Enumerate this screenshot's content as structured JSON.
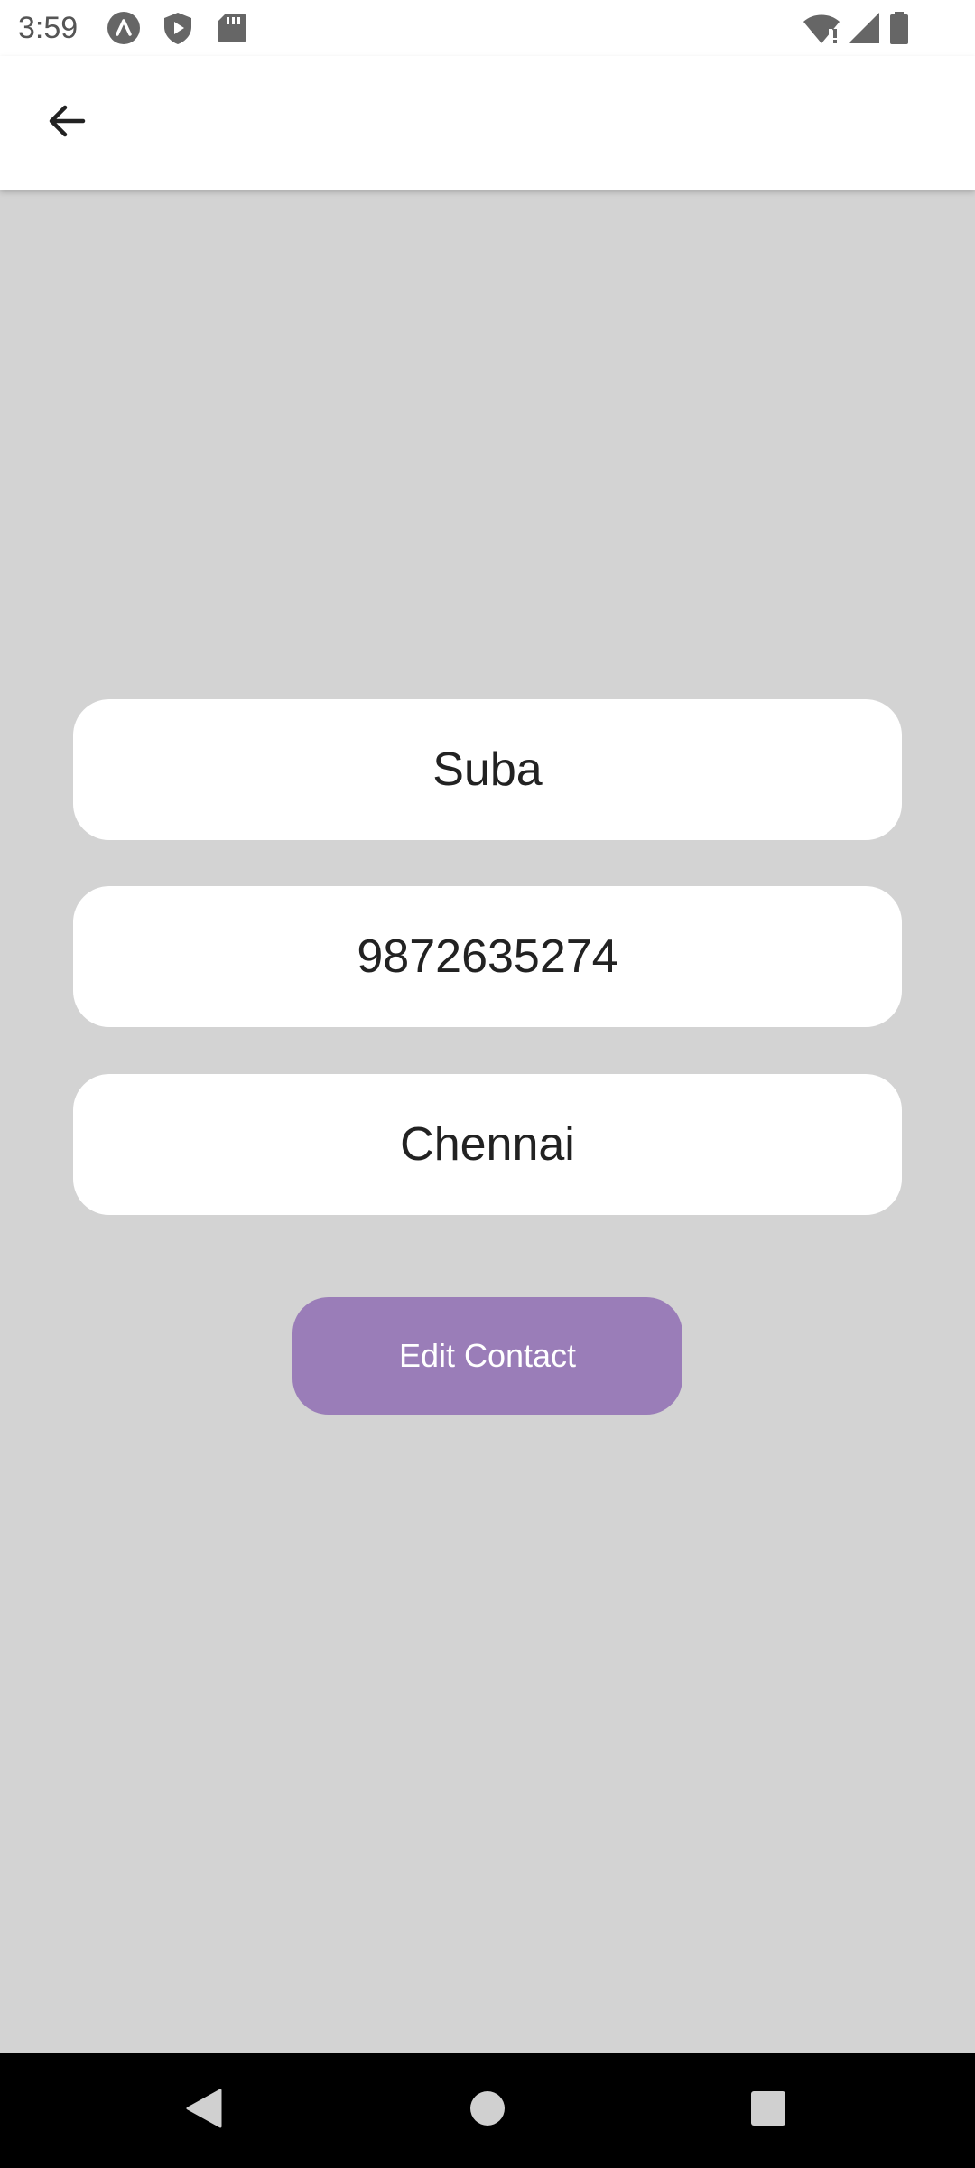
{
  "status_bar": {
    "time": "3:59",
    "left_icons": [
      "launcher-icon",
      "shield-play-icon",
      "sd-card-icon"
    ],
    "right_icons": [
      "wifi-icon",
      "signal-icon",
      "battery-icon"
    ]
  },
  "app_bar": {
    "back_icon": "arrow-back-icon"
  },
  "form": {
    "name": "Suba",
    "phone": "9872635274",
    "city": "Chennai",
    "edit_button_label": "Edit Contact"
  },
  "nav_bar": {
    "items": [
      "back-triangle-icon",
      "home-circle-icon",
      "recents-square-icon"
    ]
  },
  "colors": {
    "background": "#d3d3d3",
    "surface": "#ffffff",
    "accent": "#9a7db8",
    "nav_bar": "#000000"
  }
}
